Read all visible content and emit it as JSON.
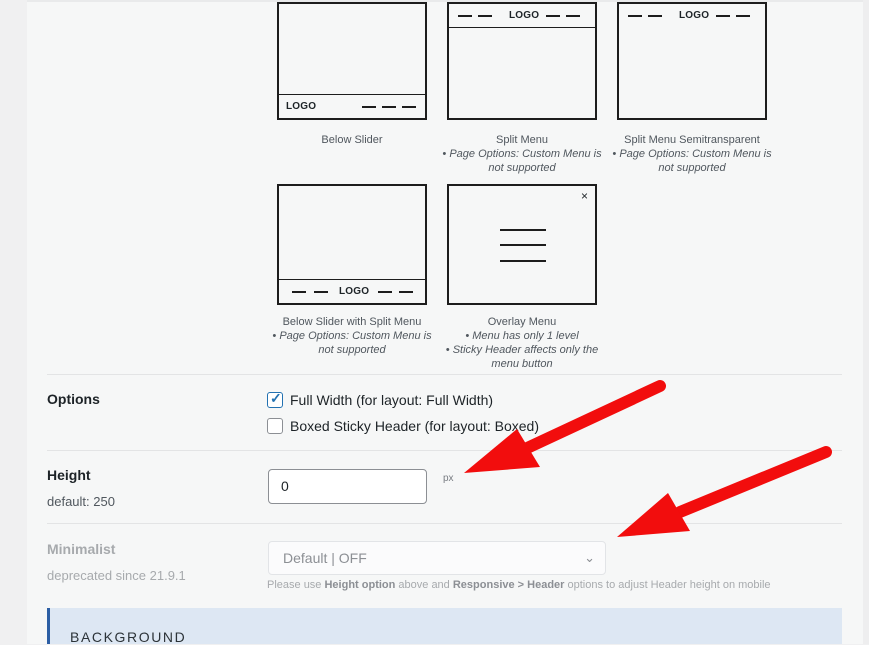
{
  "layouts": [
    {
      "id": "below-slider",
      "logo": "LOGO",
      "caption": "Below Slider",
      "notes": []
    },
    {
      "id": "split-menu",
      "logo": "LOGO",
      "caption": "Split Menu",
      "notes": [
        "• Page Options: Custom Menu is not supported"
      ]
    },
    {
      "id": "split-menu-semi",
      "logo": "LOGO",
      "caption": "Split Menu Semitransparent",
      "notes": [
        "• Page Options: Custom Menu is not supported"
      ]
    },
    {
      "id": "below-slider-split",
      "logo": "LOGO",
      "caption": "Below Slider with Split Menu",
      "notes": [
        "• Page Options: Custom Menu is not supported"
      ]
    },
    {
      "id": "overlay",
      "logo": "",
      "close_glyph": "×",
      "caption": "Overlay Menu",
      "notes": [
        "• Menu has only 1 level",
        "• Sticky Header affects only the menu button"
      ]
    }
  ],
  "options": {
    "label": "Options",
    "full_width": {
      "label": "Full Width (for layout: Full Width)",
      "checked": true
    },
    "boxed_sticky": {
      "label": "Boxed Sticky Header (for layout: Boxed)",
      "checked": false
    }
  },
  "height": {
    "label": "Height",
    "default_text": "default: 250",
    "value": "0",
    "unit": "px"
  },
  "minimalist": {
    "label": "Minimalist",
    "deprecated_text": "deprecated since 21.9.1",
    "selected": "Default | OFF",
    "help_prefix": "Please use ",
    "help_bold1": "Height option",
    "help_mid": " above and ",
    "help_bold2": "Responsive > Header",
    "help_suffix": " options to adjust Header height on mobile"
  },
  "background_section": {
    "title": "BACKGROUND"
  },
  "colors": {
    "arrow": "#f20d0d",
    "accent": "#2271b1",
    "section_bg": "#dde7f3"
  },
  "icons": {
    "check": "checkmark-icon",
    "chevron": "chevron-down-icon",
    "close": "close-icon",
    "menu": "hamburger-icon"
  }
}
